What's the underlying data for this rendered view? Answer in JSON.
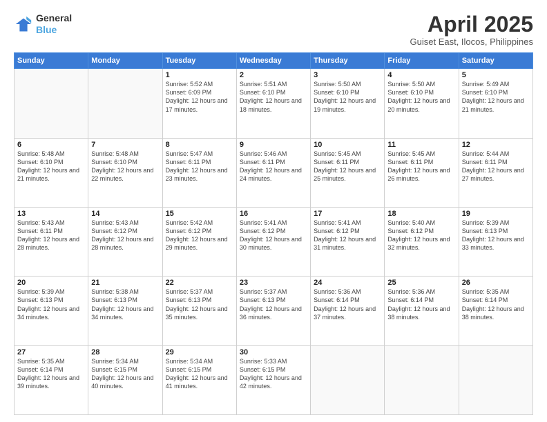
{
  "logo": {
    "line1": "General",
    "line2": "Blue"
  },
  "title": "April 2025",
  "subtitle": "Guiset East, Ilocos, Philippines",
  "days_header": [
    "Sunday",
    "Monday",
    "Tuesday",
    "Wednesday",
    "Thursday",
    "Friday",
    "Saturday"
  ],
  "weeks": [
    [
      {
        "day": "",
        "info": ""
      },
      {
        "day": "",
        "info": ""
      },
      {
        "day": "1",
        "info": "Sunrise: 5:52 AM\nSunset: 6:09 PM\nDaylight: 12 hours and 17 minutes."
      },
      {
        "day": "2",
        "info": "Sunrise: 5:51 AM\nSunset: 6:10 PM\nDaylight: 12 hours and 18 minutes."
      },
      {
        "day": "3",
        "info": "Sunrise: 5:50 AM\nSunset: 6:10 PM\nDaylight: 12 hours and 19 minutes."
      },
      {
        "day": "4",
        "info": "Sunrise: 5:50 AM\nSunset: 6:10 PM\nDaylight: 12 hours and 20 minutes."
      },
      {
        "day": "5",
        "info": "Sunrise: 5:49 AM\nSunset: 6:10 PM\nDaylight: 12 hours and 21 minutes."
      }
    ],
    [
      {
        "day": "6",
        "info": "Sunrise: 5:48 AM\nSunset: 6:10 PM\nDaylight: 12 hours and 21 minutes."
      },
      {
        "day": "7",
        "info": "Sunrise: 5:48 AM\nSunset: 6:10 PM\nDaylight: 12 hours and 22 minutes."
      },
      {
        "day": "8",
        "info": "Sunrise: 5:47 AM\nSunset: 6:11 PM\nDaylight: 12 hours and 23 minutes."
      },
      {
        "day": "9",
        "info": "Sunrise: 5:46 AM\nSunset: 6:11 PM\nDaylight: 12 hours and 24 minutes."
      },
      {
        "day": "10",
        "info": "Sunrise: 5:45 AM\nSunset: 6:11 PM\nDaylight: 12 hours and 25 minutes."
      },
      {
        "day": "11",
        "info": "Sunrise: 5:45 AM\nSunset: 6:11 PM\nDaylight: 12 hours and 26 minutes."
      },
      {
        "day": "12",
        "info": "Sunrise: 5:44 AM\nSunset: 6:11 PM\nDaylight: 12 hours and 27 minutes."
      }
    ],
    [
      {
        "day": "13",
        "info": "Sunrise: 5:43 AM\nSunset: 6:11 PM\nDaylight: 12 hours and 28 minutes."
      },
      {
        "day": "14",
        "info": "Sunrise: 5:43 AM\nSunset: 6:12 PM\nDaylight: 12 hours and 28 minutes."
      },
      {
        "day": "15",
        "info": "Sunrise: 5:42 AM\nSunset: 6:12 PM\nDaylight: 12 hours and 29 minutes."
      },
      {
        "day": "16",
        "info": "Sunrise: 5:41 AM\nSunset: 6:12 PM\nDaylight: 12 hours and 30 minutes."
      },
      {
        "day": "17",
        "info": "Sunrise: 5:41 AM\nSunset: 6:12 PM\nDaylight: 12 hours and 31 minutes."
      },
      {
        "day": "18",
        "info": "Sunrise: 5:40 AM\nSunset: 6:12 PM\nDaylight: 12 hours and 32 minutes."
      },
      {
        "day": "19",
        "info": "Sunrise: 5:39 AM\nSunset: 6:13 PM\nDaylight: 12 hours and 33 minutes."
      }
    ],
    [
      {
        "day": "20",
        "info": "Sunrise: 5:39 AM\nSunset: 6:13 PM\nDaylight: 12 hours and 34 minutes."
      },
      {
        "day": "21",
        "info": "Sunrise: 5:38 AM\nSunset: 6:13 PM\nDaylight: 12 hours and 34 minutes."
      },
      {
        "day": "22",
        "info": "Sunrise: 5:37 AM\nSunset: 6:13 PM\nDaylight: 12 hours and 35 minutes."
      },
      {
        "day": "23",
        "info": "Sunrise: 5:37 AM\nSunset: 6:13 PM\nDaylight: 12 hours and 36 minutes."
      },
      {
        "day": "24",
        "info": "Sunrise: 5:36 AM\nSunset: 6:14 PM\nDaylight: 12 hours and 37 minutes."
      },
      {
        "day": "25",
        "info": "Sunrise: 5:36 AM\nSunset: 6:14 PM\nDaylight: 12 hours and 38 minutes."
      },
      {
        "day": "26",
        "info": "Sunrise: 5:35 AM\nSunset: 6:14 PM\nDaylight: 12 hours and 38 minutes."
      }
    ],
    [
      {
        "day": "27",
        "info": "Sunrise: 5:35 AM\nSunset: 6:14 PM\nDaylight: 12 hours and 39 minutes."
      },
      {
        "day": "28",
        "info": "Sunrise: 5:34 AM\nSunset: 6:15 PM\nDaylight: 12 hours and 40 minutes."
      },
      {
        "day": "29",
        "info": "Sunrise: 5:34 AM\nSunset: 6:15 PM\nDaylight: 12 hours and 41 minutes."
      },
      {
        "day": "30",
        "info": "Sunrise: 5:33 AM\nSunset: 6:15 PM\nDaylight: 12 hours and 42 minutes."
      },
      {
        "day": "",
        "info": ""
      },
      {
        "day": "",
        "info": ""
      },
      {
        "day": "",
        "info": ""
      }
    ]
  ]
}
